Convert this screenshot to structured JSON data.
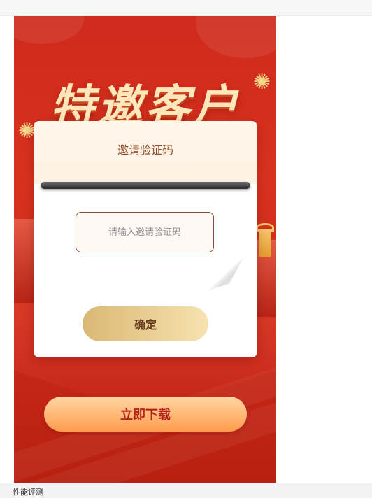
{
  "page": {
    "headline": "特邀客户"
  },
  "invite_card": {
    "title": "邀请验证码",
    "input_placeholder": "请输入邀请验证码",
    "input_value": "",
    "confirm_label": "确定"
  },
  "download": {
    "label": "立即下载"
  },
  "devtools": {
    "tab_label": "性能评测"
  },
  "colors": {
    "background_red": "#d8321f",
    "headline_cream": "#ffe7bb",
    "confirm_gold": "#e8cb8c",
    "download_orange": "#ffb070",
    "download_text": "#b3231b"
  },
  "icons": [
    "firework-icon",
    "gift-icon"
  ]
}
